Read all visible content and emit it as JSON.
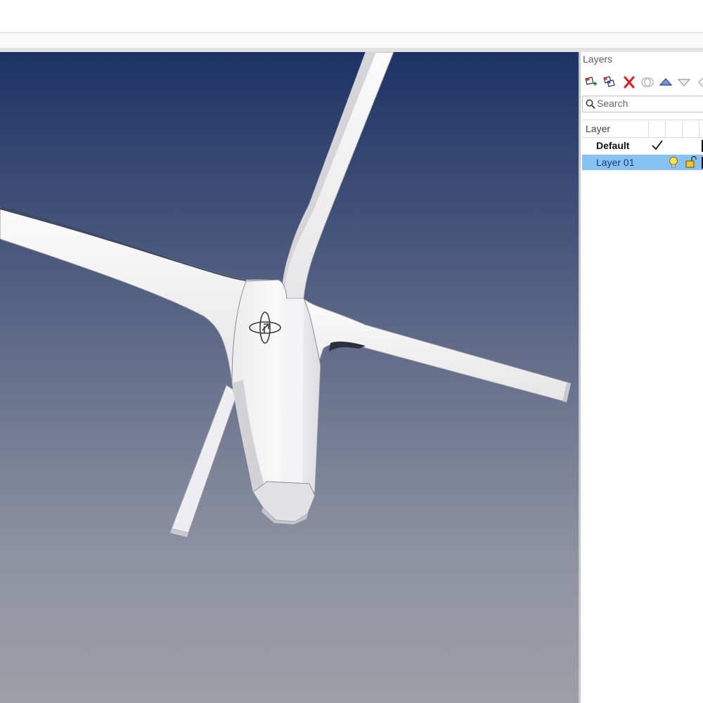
{
  "viewport": {
    "gizmo_icon": "gumball-icon"
  },
  "layers_panel": {
    "title": "Layers",
    "toolbar": [
      {
        "name": "new-layer-icon"
      },
      {
        "name": "new-sublayer-icon"
      },
      {
        "name": "delete-icon"
      },
      {
        "name": "filter-icon"
      },
      {
        "name": "move-up-icon"
      },
      {
        "name": "move-down-icon"
      },
      {
        "name": "more-icon"
      }
    ],
    "search": {
      "placeholder": "Search",
      "value": ""
    },
    "header": {
      "column_name": "Layer"
    },
    "rows": [
      {
        "name": "Default",
        "current": true,
        "current_icon": "checkmark-icon",
        "color": "#111111"
      },
      {
        "name": "Layer 01",
        "selected": true,
        "visible_icon": "lightbulb-icon",
        "lock_icon": "unlocked-padlock-icon",
        "color": "#111111"
      }
    ]
  },
  "colors": {
    "viewport_top": "#1d3366",
    "viewport_bottom": "#9e9fa6",
    "selection": "#88c2f2",
    "delete_red": "#d81e1e"
  }
}
